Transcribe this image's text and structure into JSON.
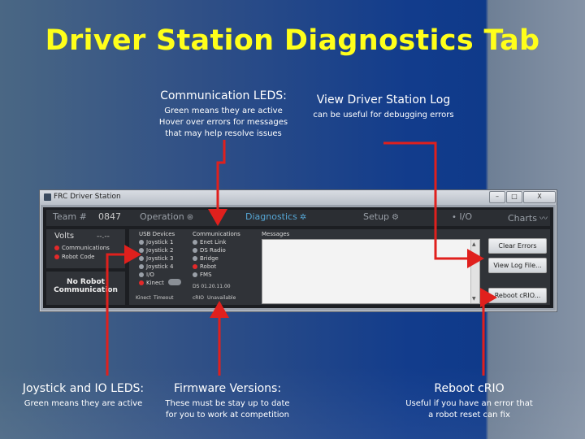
{
  "slide": {
    "title": "Driver Station Diagnostics Tab",
    "captions": {
      "communication": {
        "heading": "Communication LEDS:",
        "line1": "Green means they are active",
        "line2": "Hover over errors for messages",
        "line3": "that may help resolve issues"
      },
      "log": {
        "heading": "View Driver Station Log",
        "line1": "can be useful for debugging errors"
      },
      "joystick": {
        "heading": "Joystick and IO LEDS:",
        "line1": "Green means they are active"
      },
      "firmware": {
        "heading": "Firmware Versions:",
        "line1": "These must be stay up to date",
        "line2": "for you to work at competition"
      },
      "reboot": {
        "heading": "Reboot cRIO",
        "line1": "Useful if you have an error that",
        "line2": "a robot reset can fix"
      }
    },
    "arrow_color": "#e0201d"
  },
  "window": {
    "title": "FRC Driver Station",
    "controls": {
      "minimize": "–",
      "maximize": "□",
      "close": "X"
    },
    "tabs": {
      "team_label": "Team #",
      "team_number": "0847",
      "operation": "Operation",
      "diagnostics": "Diagnostics",
      "setup": "Setup",
      "io": "I/O",
      "charts": "Charts"
    },
    "status": {
      "volts_label": "Volts",
      "volts_value": "--.--",
      "communications": "Communications",
      "robot_code": "Robot Code",
      "no_robot_line1": "No Robot",
      "no_robot_line2": "Communication"
    },
    "diagnostics": {
      "usb_header": "USB Devices",
      "usb_items": [
        "Joystick 1",
        "Joystick 2",
        "Joystick 3",
        "Joystick 4",
        "I/O",
        "Kinect"
      ],
      "comm_header": "Communications",
      "comm_items": [
        "Enet Link",
        "DS Radio",
        "Bridge",
        "Robot",
        "FMS"
      ],
      "messages_header": "Messages",
      "ds_version": "DS  01.20.11.00",
      "crio_label": "cRIO",
      "crio_value": "Unavailable",
      "kinect_label": "Kinect",
      "kinect_value": "Timeout",
      "clear_errors": "Clear Errors",
      "view_log": "View Log File...",
      "reboot": "Reboot cRIO..."
    }
  }
}
